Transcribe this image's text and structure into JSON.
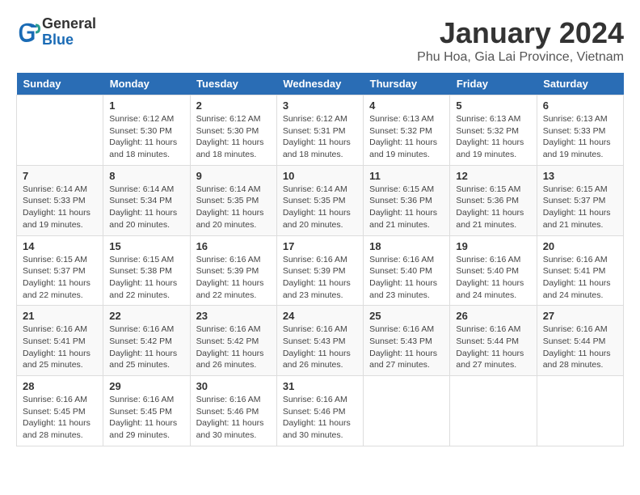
{
  "header": {
    "logo_line1": "General",
    "logo_line2": "Blue",
    "title": "January 2024",
    "subtitle": "Phu Hoa, Gia Lai Province, Vietnam"
  },
  "days_of_week": [
    "Sunday",
    "Monday",
    "Tuesday",
    "Wednesday",
    "Thursday",
    "Friday",
    "Saturday"
  ],
  "weeks": [
    [
      {
        "day": "",
        "info": ""
      },
      {
        "day": "1",
        "info": "Sunrise: 6:12 AM\nSunset: 5:30 PM\nDaylight: 11 hours\nand 18 minutes."
      },
      {
        "day": "2",
        "info": "Sunrise: 6:12 AM\nSunset: 5:30 PM\nDaylight: 11 hours\nand 18 minutes."
      },
      {
        "day": "3",
        "info": "Sunrise: 6:12 AM\nSunset: 5:31 PM\nDaylight: 11 hours\nand 18 minutes."
      },
      {
        "day": "4",
        "info": "Sunrise: 6:13 AM\nSunset: 5:32 PM\nDaylight: 11 hours\nand 19 minutes."
      },
      {
        "day": "5",
        "info": "Sunrise: 6:13 AM\nSunset: 5:32 PM\nDaylight: 11 hours\nand 19 minutes."
      },
      {
        "day": "6",
        "info": "Sunrise: 6:13 AM\nSunset: 5:33 PM\nDaylight: 11 hours\nand 19 minutes."
      }
    ],
    [
      {
        "day": "7",
        "info": "Sunrise: 6:14 AM\nSunset: 5:33 PM\nDaylight: 11 hours\nand 19 minutes."
      },
      {
        "day": "8",
        "info": "Sunrise: 6:14 AM\nSunset: 5:34 PM\nDaylight: 11 hours\nand 20 minutes."
      },
      {
        "day": "9",
        "info": "Sunrise: 6:14 AM\nSunset: 5:35 PM\nDaylight: 11 hours\nand 20 minutes."
      },
      {
        "day": "10",
        "info": "Sunrise: 6:14 AM\nSunset: 5:35 PM\nDaylight: 11 hours\nand 20 minutes."
      },
      {
        "day": "11",
        "info": "Sunrise: 6:15 AM\nSunset: 5:36 PM\nDaylight: 11 hours\nand 21 minutes."
      },
      {
        "day": "12",
        "info": "Sunrise: 6:15 AM\nSunset: 5:36 PM\nDaylight: 11 hours\nand 21 minutes."
      },
      {
        "day": "13",
        "info": "Sunrise: 6:15 AM\nSunset: 5:37 PM\nDaylight: 11 hours\nand 21 minutes."
      }
    ],
    [
      {
        "day": "14",
        "info": "Sunrise: 6:15 AM\nSunset: 5:37 PM\nDaylight: 11 hours\nand 22 minutes."
      },
      {
        "day": "15",
        "info": "Sunrise: 6:15 AM\nSunset: 5:38 PM\nDaylight: 11 hours\nand 22 minutes."
      },
      {
        "day": "16",
        "info": "Sunrise: 6:16 AM\nSunset: 5:39 PM\nDaylight: 11 hours\nand 22 minutes."
      },
      {
        "day": "17",
        "info": "Sunrise: 6:16 AM\nSunset: 5:39 PM\nDaylight: 11 hours\nand 23 minutes."
      },
      {
        "day": "18",
        "info": "Sunrise: 6:16 AM\nSunset: 5:40 PM\nDaylight: 11 hours\nand 23 minutes."
      },
      {
        "day": "19",
        "info": "Sunrise: 6:16 AM\nSunset: 5:40 PM\nDaylight: 11 hours\nand 24 minutes."
      },
      {
        "day": "20",
        "info": "Sunrise: 6:16 AM\nSunset: 5:41 PM\nDaylight: 11 hours\nand 24 minutes."
      }
    ],
    [
      {
        "day": "21",
        "info": "Sunrise: 6:16 AM\nSunset: 5:41 PM\nDaylight: 11 hours\nand 25 minutes."
      },
      {
        "day": "22",
        "info": "Sunrise: 6:16 AM\nSunset: 5:42 PM\nDaylight: 11 hours\nand 25 minutes."
      },
      {
        "day": "23",
        "info": "Sunrise: 6:16 AM\nSunset: 5:42 PM\nDaylight: 11 hours\nand 26 minutes."
      },
      {
        "day": "24",
        "info": "Sunrise: 6:16 AM\nSunset: 5:43 PM\nDaylight: 11 hours\nand 26 minutes."
      },
      {
        "day": "25",
        "info": "Sunrise: 6:16 AM\nSunset: 5:43 PM\nDaylight: 11 hours\nand 27 minutes."
      },
      {
        "day": "26",
        "info": "Sunrise: 6:16 AM\nSunset: 5:44 PM\nDaylight: 11 hours\nand 27 minutes."
      },
      {
        "day": "27",
        "info": "Sunrise: 6:16 AM\nSunset: 5:44 PM\nDaylight: 11 hours\nand 28 minutes."
      }
    ],
    [
      {
        "day": "28",
        "info": "Sunrise: 6:16 AM\nSunset: 5:45 PM\nDaylight: 11 hours\nand 28 minutes."
      },
      {
        "day": "29",
        "info": "Sunrise: 6:16 AM\nSunset: 5:45 PM\nDaylight: 11 hours\nand 29 minutes."
      },
      {
        "day": "30",
        "info": "Sunrise: 6:16 AM\nSunset: 5:46 PM\nDaylight: 11 hours\nand 30 minutes."
      },
      {
        "day": "31",
        "info": "Sunrise: 6:16 AM\nSunset: 5:46 PM\nDaylight: 11 hours\nand 30 minutes."
      },
      {
        "day": "",
        "info": ""
      },
      {
        "day": "",
        "info": ""
      },
      {
        "day": "",
        "info": ""
      }
    ]
  ]
}
